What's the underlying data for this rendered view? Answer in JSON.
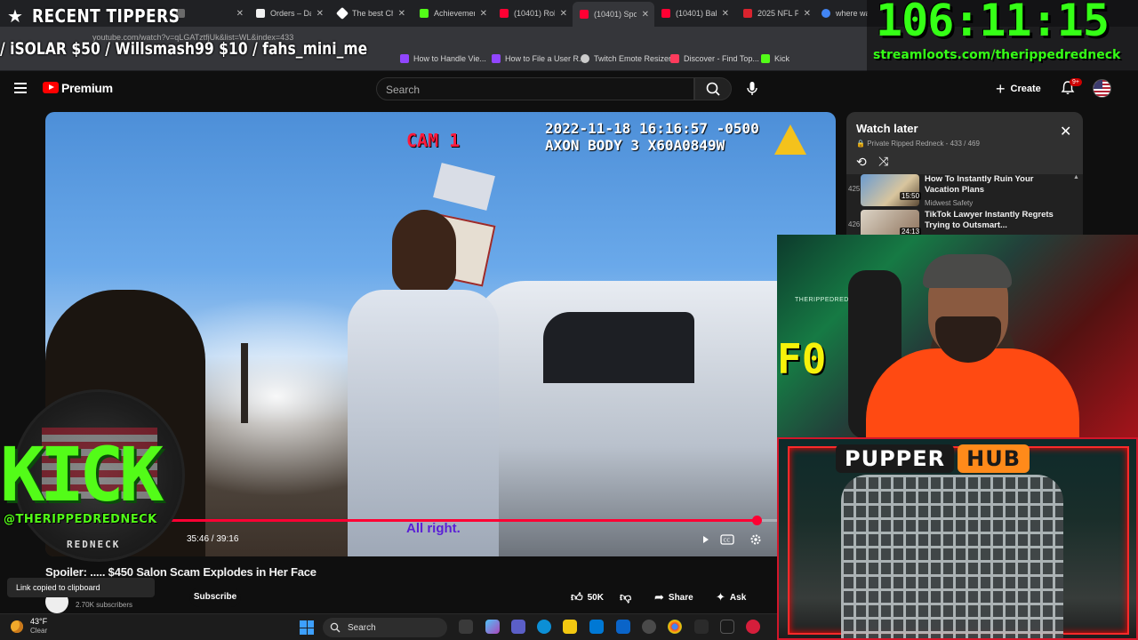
{
  "browser": {
    "tabs": [
      {
        "title": "",
        "color": "#6a6a6a"
      },
      {
        "title": "Orders – Da",
        "color": "#f1f1f1"
      },
      {
        "title": "The best Ch",
        "color": "#ffffff"
      },
      {
        "title": "Achievemen",
        "color": "#53fc18"
      },
      {
        "title": "(10401) Rob",
        "color": "#ff0033"
      },
      {
        "title": "(10401) Spo",
        "color": "#ff0033"
      },
      {
        "title": "(10401) Balt",
        "color": "#ff0033"
      },
      {
        "title": "2025 NFL Pl",
        "color": "#d9232e"
      },
      {
        "title": "where was",
        "color": "#4285f4"
      }
    ],
    "url": "youtube.com/watch?v=qLGATztfjUk&list=WL&index=433",
    "bookmarks": [
      {
        "label": "How to Handle Vie...",
        "color": "#9146ff"
      },
      {
        "label": "How to File a User R...",
        "color": "#9146ff"
      },
      {
        "label": "Twitch Emote Resizer",
        "color": "#cccccc"
      },
      {
        "label": "Discover - Find Top...",
        "color": "#ff3b5c"
      },
      {
        "label": "Kick",
        "color": "#53fc18"
      }
    ]
  },
  "overlay": {
    "tippers_title": "RECENT TIPPERS",
    "tippers_list": "/ iSOLAR $50 / Willsmash99 $10 / fahs_mini_me",
    "timer": "106:11:15",
    "timer_url": "streamloots.com/therippedredneck",
    "kick_word": "KICK",
    "kick_handle": "@THERIPPEDREDNECK",
    "kick_sub": "REDNECK",
    "pupper_word": "PUPPER",
    "pupper_hub": "HUB",
    "webcam_sign": "THERIPPEDREDNECK"
  },
  "youtube": {
    "brand": "Premium",
    "search_placeholder": "Search",
    "create_label": "Create",
    "notif_badge": "9+",
    "video": {
      "cam_label": "CAM 1",
      "osd_line1": "2022-11-18 16:16:57 -0500",
      "osd_line2": "AXON BODY 3 X60A0849W",
      "subtitle": "All right.",
      "time": "35:46 / 39:16",
      "progress": 0.911
    },
    "video_title": "Spoiler: ..... $450 Salon Scam Explodes in Her Face",
    "subscribers": "2.70K subscribers",
    "subscribe_label": "Subscribe",
    "likes": "50K",
    "share_label": "Share",
    "ask_label": "Ask",
    "toast": "Link copied to clipboard",
    "watch_later": {
      "title": "Watch later",
      "subtitle": "Private Ripped Redneck - 433 / 469",
      "items": [
        {
          "index": "425",
          "title": "How To Instantly Ruin Your Vacation Plans",
          "channel": "Midwest Safety",
          "duration": "15:50"
        },
        {
          "index": "426",
          "title": "TikTok Lawyer Instantly Regrets Trying to Outsmart...",
          "channel": "",
          "duration": "24:13"
        }
      ]
    }
  },
  "taskbar": {
    "temp": "43°F",
    "weather": "Clear",
    "search_label": "Search"
  }
}
